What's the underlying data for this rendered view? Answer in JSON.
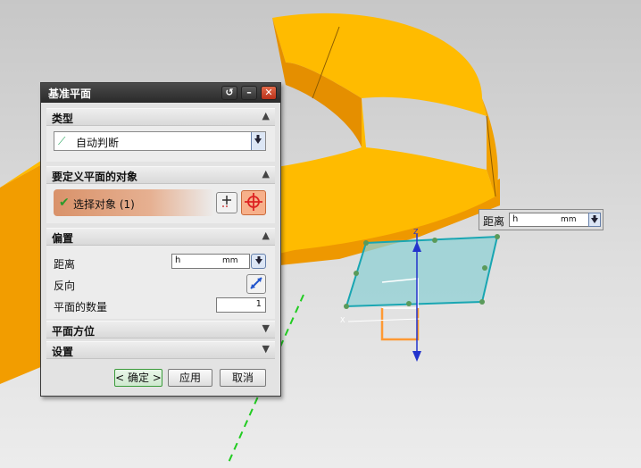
{
  "dialog": {
    "title": "基准平面",
    "sections": {
      "type": {
        "header": "类型",
        "combo_value": "自动判断"
      },
      "objects": {
        "header": "要定义平面的对象",
        "select_label": "选择对象 (1)"
      },
      "offset": {
        "header": "偏置",
        "distance_label": "距离",
        "distance_value": "h",
        "distance_unit": "mm",
        "reverse_label": "反向",
        "count_label": "平面的数量",
        "count_value": "1"
      },
      "orientation": {
        "header": "平面方位"
      },
      "settings": {
        "header": "设置"
      }
    },
    "buttons": {
      "ok": "< 确定 >",
      "apply": "应用",
      "cancel": "取消"
    }
  },
  "floating_distance": {
    "label": "距离",
    "value": "h",
    "unit": "mm"
  },
  "axes": {
    "x": "X",
    "z": "Z"
  },
  "colors": {
    "part": "#ffba00",
    "part_side": "#f29d00",
    "plane": "#8fd0d4",
    "plane_edge": "#19a6b2"
  },
  "icons": [
    "reset-icon",
    "minimize-icon",
    "close-icon",
    "check-icon",
    "add-object-icon",
    "crosshair-icon",
    "reverse-icon",
    "dropdown-icon",
    "collapse-icon",
    "expand-icon"
  ]
}
